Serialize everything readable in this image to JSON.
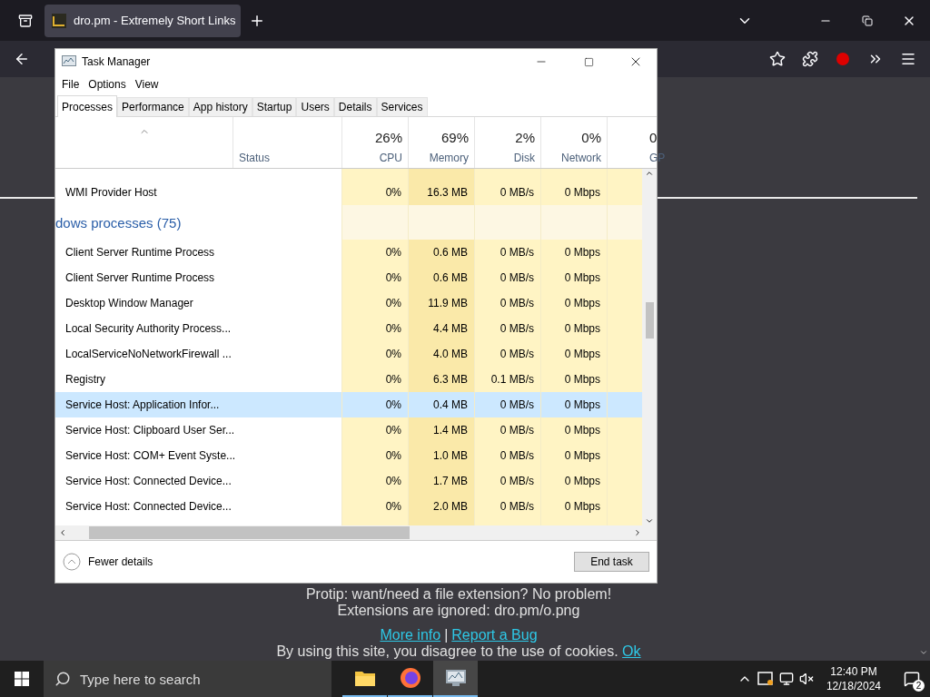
{
  "browser": {
    "tab": {
      "title": "dro.pm - Extremely Short Links"
    }
  },
  "page": {
    "protip": "Protip: want/need a file extension? No problem!",
    "extensions": "Extensions are ignored: dro.pm/o.png",
    "links": [
      {
        "text": "More info"
      },
      {
        "text": "Report a Bug"
      }
    ],
    "separator": "|",
    "cookie_notice": "By using this site, you disagree to the use of cookies.",
    "cookie_ok": "Ok"
  },
  "task_manager": {
    "title": "Task Manager",
    "menu": [
      "File",
      "Options",
      "View"
    ],
    "tabs": [
      {
        "label": "Processes",
        "selected": true
      },
      {
        "label": "Performance",
        "selected": false
      },
      {
        "label": "App history",
        "selected": false
      },
      {
        "label": "Startup",
        "selected": false
      },
      {
        "label": "Users",
        "selected": false
      },
      {
        "label": "Details",
        "selected": false
      },
      {
        "label": "Services",
        "selected": false
      }
    ],
    "columns": [
      {
        "label": "Status"
      },
      {
        "label": "CPU",
        "usage": "26%"
      },
      {
        "label": "Memory",
        "usage": "69%"
      },
      {
        "label": "Disk",
        "usage": "2%"
      },
      {
        "label": "Network",
        "usage": "0%"
      },
      {
        "label": "GP",
        "usage": "0"
      }
    ],
    "rows_before": [
      {
        "name": "WMI Provider Host",
        "cpu": "0%",
        "memory": "16.3 MB",
        "disk": "0 MB/s",
        "network": "0 Mbps",
        "selected": false
      }
    ],
    "group": {
      "label": "dows processes (75)"
    },
    "rows": [
      {
        "name": "Client Server Runtime Process",
        "cpu": "0%",
        "memory": "0.6 MB",
        "disk": "0 MB/s",
        "network": "0 Mbps",
        "selected": false
      },
      {
        "name": "Client Server Runtime Process",
        "cpu": "0%",
        "memory": "0.6 MB",
        "disk": "0 MB/s",
        "network": "0 Mbps",
        "selected": false
      },
      {
        "name": "Desktop Window Manager",
        "cpu": "0%",
        "memory": "11.9 MB",
        "disk": "0 MB/s",
        "network": "0 Mbps",
        "selected": false
      },
      {
        "name": "Local Security Authority Process...",
        "cpu": "0%",
        "memory": "4.4 MB",
        "disk": "0 MB/s",
        "network": "0 Mbps",
        "selected": false
      },
      {
        "name": "LocalServiceNoNetworkFirewall ...",
        "cpu": "0%",
        "memory": "4.0 MB",
        "disk": "0 MB/s",
        "network": "0 Mbps",
        "selected": false
      },
      {
        "name": "Registry",
        "cpu": "0%",
        "memory": "6.3 MB",
        "disk": "0.1 MB/s",
        "network": "0 Mbps",
        "selected": false
      },
      {
        "name": "Service Host: Application Infor...",
        "cpu": "0%",
        "memory": "0.4 MB",
        "disk": "0 MB/s",
        "network": "0 Mbps",
        "selected": true
      },
      {
        "name": "Service Host: Clipboard User Ser...",
        "cpu": "0%",
        "memory": "1.4 MB",
        "disk": "0 MB/s",
        "network": "0 Mbps",
        "selected": false
      },
      {
        "name": "Service Host: COM+ Event Syste...",
        "cpu": "0%",
        "memory": "1.0 MB",
        "disk": "0 MB/s",
        "network": "0 Mbps",
        "selected": false
      },
      {
        "name": "Service Host: Connected Device...",
        "cpu": "0%",
        "memory": "1.7 MB",
        "disk": "0 MB/s",
        "network": "0 Mbps",
        "selected": false
      },
      {
        "name": "Service Host: Connected Device...",
        "cpu": "0%",
        "memory": "2.0 MB",
        "disk": "0 MB/s",
        "network": "0 Mbps",
        "selected": false
      }
    ],
    "footer": {
      "toggle": "Fewer details",
      "button": "End task"
    }
  },
  "taskbar": {
    "search_placeholder": "Type here to search",
    "apps": [
      {
        "kind": "folder",
        "active": false
      },
      {
        "kind": "firefox",
        "active": false
      },
      {
        "kind": "taskmanager",
        "active": true
      }
    ],
    "time": "12:40 PM",
    "date": "12/18/2024",
    "notifications": "2"
  }
}
